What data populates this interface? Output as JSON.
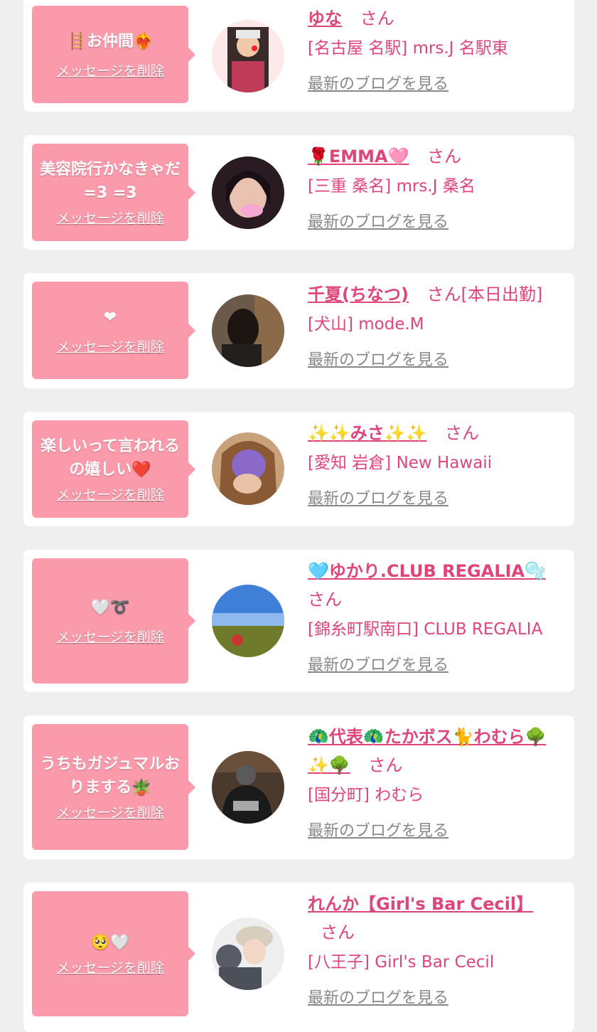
{
  "colors": {
    "background": "#efefef",
    "card": "#ffffff",
    "bubble": "#fb9aab",
    "name": "#e0457a",
    "blog_link": "#888888"
  },
  "items": [
    {
      "message": "🪜お仲間❤️‍🔥",
      "delete_label": "メッセージを削除",
      "name": "ゆな",
      "san": "さん",
      "shop": "[名古屋 名駅] mrs.J 名駅東",
      "blog_label": "最新のブログを見る",
      "avatar_icon": "avatar-yuna"
    },
    {
      "message": "美容院行かなきゃだ=3 =3",
      "delete_label": "メッセージを削除",
      "name": "🌹EMMA🩷",
      "san": "さん",
      "shop": "[三重 桑名] mrs.J 桑名",
      "blog_label": "最新のブログを見る",
      "avatar_icon": "avatar-emma"
    },
    {
      "message": "❤",
      "delete_label": "メッセージを削除",
      "name": "千夏(ちなつ)",
      "san": "さん[本日出勤]",
      "shop": "[犬山] mode.M",
      "blog_label": "最新のブログを見る",
      "avatar_icon": "avatar-chinatsu"
    },
    {
      "message": "楽しいって言われるの嬉しい❤️",
      "delete_label": "メッセージを削除",
      "name": "✨✨みさ✨✨",
      "san": "さん",
      "shop": "[愛知 岩倉] New Hawaii",
      "blog_label": "最新のブログを見る",
      "avatar_icon": "avatar-misa"
    },
    {
      "message": "🤍➰",
      "delete_label": "メッセージを削除",
      "name": "🩵ゆかり.CLUB REGALIA🫧",
      "san": "さん",
      "shop": "[錦糸町駅南口] CLUB REGALIA",
      "blog_label": "最新のブログを見る",
      "avatar_icon": "avatar-yukari"
    },
    {
      "message": "うちもガジュマルおりまする🪴",
      "delete_label": "メッセージを削除",
      "name": "🦚代表🦚たかボス🐈わむら🌳✨🌳",
      "san": "さん",
      "shop": "[国分町] わむら",
      "blog_label": "最新のブログを見る",
      "avatar_icon": "avatar-takaboss"
    },
    {
      "message": "🥺🤍",
      "delete_label": "メッセージを削除",
      "name": "れんか【Girl's Bar Cecil】",
      "san": "さん",
      "shop": "[八王子] Girl's Bar Cecil",
      "blog_label": "最新のブログを見る",
      "avatar_icon": "avatar-renka"
    }
  ]
}
